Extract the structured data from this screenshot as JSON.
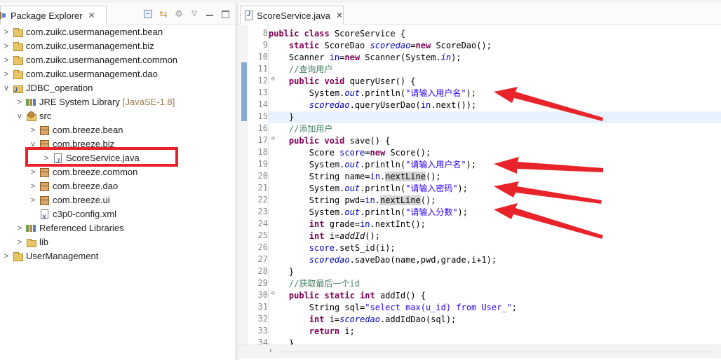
{
  "package_explorer": {
    "title": "Package Explorer",
    "close_glyph": "✕",
    "tools": [
      "collapse-all-icon",
      "link-with-editor-icon",
      "filters-icon",
      "view-menu-icon",
      "minimize-icon",
      "maximize-icon"
    ],
    "tree": [
      {
        "label": "com.zuikc.usermanagement.bean",
        "icon": "project-icon",
        "indent": 0,
        "toggle": ">"
      },
      {
        "label": "com.zuikc.usermanagement.biz",
        "icon": "project-icon",
        "indent": 0,
        "toggle": ">"
      },
      {
        "label": "com.zuikc.usermanagement.common",
        "icon": "project-icon",
        "indent": 0,
        "toggle": ">"
      },
      {
        "label": "com.zuikc.usermanagement.dao",
        "icon": "project-icon",
        "indent": 0,
        "toggle": ">"
      },
      {
        "label": "JDBC_operation",
        "icon": "java-project-icon",
        "indent": 0,
        "toggle": "v"
      },
      {
        "label": "JRE System Library",
        "decoration": "[JavaSE-1.8]",
        "icon": "library-icon",
        "indent": 1,
        "toggle": ">"
      },
      {
        "label": "src",
        "icon": "source-folder-icon",
        "indent": 1,
        "toggle": "v"
      },
      {
        "label": "com.breeze.bean",
        "icon": "package-icon",
        "indent": 2,
        "toggle": ">"
      },
      {
        "label": "com.breeze.biz",
        "icon": "package-icon",
        "indent": 2,
        "toggle": "v"
      },
      {
        "label": "ScoreService.java",
        "icon": "java-file-icon",
        "indent": 3,
        "toggle": ">"
      },
      {
        "label": "com.breeze.common",
        "icon": "package-icon",
        "indent": 2,
        "toggle": ">"
      },
      {
        "label": "com.breeze.dao",
        "icon": "package-icon",
        "indent": 2,
        "toggle": ">"
      },
      {
        "label": "com.breeze.ui",
        "icon": "package-icon",
        "indent": 2,
        "toggle": ">"
      },
      {
        "label": "c3p0-config.xml",
        "icon": "xml-file-icon",
        "indent": 2,
        "toggle": ""
      },
      {
        "label": "Referenced Libraries",
        "icon": "library-icon",
        "indent": 1,
        "toggle": ">"
      },
      {
        "label": "lib",
        "icon": "folder-icon",
        "indent": 1,
        "toggle": ">"
      },
      {
        "label": "UserManagement",
        "icon": "project-icon",
        "indent": 0,
        "toggle": ">"
      }
    ]
  },
  "editor": {
    "tab_title": "ScoreService.java",
    "close_glyph": "✕",
    "current_line": 15,
    "lines": [
      {
        "n": "8",
        "tokens": [
          [
            "kw",
            "public "
          ],
          [
            "kw",
            "class "
          ],
          [
            "",
            "ScoreService {"
          ]
        ]
      },
      {
        "n": "9",
        "tokens": [
          [
            "",
            "    "
          ],
          [
            "kw",
            "static "
          ],
          [
            "",
            "ScoreDao "
          ],
          [
            "sfld",
            "scoredao"
          ],
          [
            "",
            "="
          ],
          [
            "kw",
            "new "
          ],
          [
            "",
            "ScoreDao();"
          ]
        ]
      },
      {
        "n": "10",
        "tokens": [
          [
            "",
            "    Scanner "
          ],
          [
            "fld",
            "in"
          ],
          [
            "",
            "="
          ],
          [
            "kw",
            "new "
          ],
          [
            "",
            "Scanner(System."
          ],
          [
            "sfld",
            "in"
          ],
          [
            "",
            ");"
          ]
        ]
      },
      {
        "n": "11",
        "tokens": [
          [
            "",
            "    "
          ],
          [
            "com",
            "//查询用户"
          ]
        ]
      },
      {
        "n": "12",
        "fold": "⊖",
        "tokens": [
          [
            "",
            "    "
          ],
          [
            "kw",
            "public "
          ],
          [
            "kw",
            "void "
          ],
          [
            "",
            "queryUser() {"
          ]
        ]
      },
      {
        "n": "13",
        "tokens": [
          [
            "",
            "        System."
          ],
          [
            "sfld",
            "out"
          ],
          [
            "",
            ".println("
          ],
          [
            "str",
            "\"请输入用户名\""
          ],
          [
            "",
            ");"
          ]
        ]
      },
      {
        "n": "14",
        "tokens": [
          [
            "",
            "        "
          ],
          [
            "sfld",
            "scoredao"
          ],
          [
            "",
            ".queryUserDao("
          ],
          [
            "fld",
            "in"
          ],
          [
            "",
            ".next());"
          ]
        ]
      },
      {
        "n": "15",
        "tokens": [
          [
            "",
            "    }"
          ]
        ]
      },
      {
        "n": "16",
        "tokens": [
          [
            "",
            "    "
          ],
          [
            "com",
            "//添加用户"
          ]
        ]
      },
      {
        "n": "17",
        "fold": "⊖",
        "tokens": [
          [
            "",
            "    "
          ],
          [
            "kw",
            "public "
          ],
          [
            "kw",
            "void "
          ],
          [
            "",
            "save() {"
          ]
        ]
      },
      {
        "n": "18",
        "tokens": [
          [
            "",
            "        Score "
          ],
          [
            "fld",
            "score"
          ],
          [
            "",
            "="
          ],
          [
            "kw",
            "new "
          ],
          [
            "",
            "Score();"
          ]
        ]
      },
      {
        "n": "19",
        "tokens": [
          [
            "",
            "        System."
          ],
          [
            "sfld",
            "out"
          ],
          [
            "",
            ".println("
          ],
          [
            "str",
            "\"请输入用户名\""
          ],
          [
            "",
            ");"
          ]
        ]
      },
      {
        "n": "20",
        "tokens": [
          [
            "",
            "        String name="
          ],
          [
            "fld",
            "in"
          ],
          [
            "",
            "."
          ],
          [
            "occ",
            "nextLine"
          ],
          [
            "",
            "();"
          ]
        ]
      },
      {
        "n": "21",
        "tokens": [
          [
            "",
            "        System."
          ],
          [
            "sfld",
            "out"
          ],
          [
            "",
            ".println("
          ],
          [
            "str",
            "\"请输入密码\""
          ],
          [
            "",
            ");"
          ]
        ]
      },
      {
        "n": "22",
        "tokens": [
          [
            "",
            "        String pwd="
          ],
          [
            "fld",
            "in"
          ],
          [
            "",
            "."
          ],
          [
            "occ",
            "nextLine"
          ],
          [
            "",
            "();"
          ]
        ]
      },
      {
        "n": "23",
        "tokens": [
          [
            "",
            "        System."
          ],
          [
            "sfld",
            "out"
          ],
          [
            "",
            ".println("
          ],
          [
            "str",
            "\"请输入分数\""
          ],
          [
            "",
            ");"
          ]
        ]
      },
      {
        "n": "24",
        "tokens": [
          [
            "",
            "        "
          ],
          [
            "kw",
            "int "
          ],
          [
            "",
            "grade="
          ],
          [
            "fld",
            "in"
          ],
          [
            "",
            ".nextInt();"
          ]
        ]
      },
      {
        "n": "25",
        "tokens": [
          [
            "",
            "        "
          ],
          [
            "kw",
            "int "
          ],
          [
            "",
            "i="
          ],
          [
            "mth",
            "addId"
          ],
          [
            "",
            "();"
          ]
        ]
      },
      {
        "n": "26",
        "tokens": [
          [
            "",
            "        "
          ],
          [
            "fld",
            "score"
          ],
          [
            "",
            ".setS_id(i);"
          ]
        ]
      },
      {
        "n": "27",
        "tokens": [
          [
            "",
            "        "
          ],
          [
            "sfld",
            "scoredao"
          ],
          [
            "",
            ".saveDao(name,pwd,grade,i+1);"
          ]
        ]
      },
      {
        "n": "28",
        "tokens": [
          [
            "",
            "    }"
          ]
        ]
      },
      {
        "n": "29",
        "tokens": [
          [
            "",
            "    "
          ],
          [
            "com",
            "//获取最后一个id"
          ]
        ]
      },
      {
        "n": "30",
        "fold": "⊖",
        "tokens": [
          [
            "",
            "    "
          ],
          [
            "kw",
            "public "
          ],
          [
            "kw",
            "static "
          ],
          [
            "kw",
            "int "
          ],
          [
            "",
            "addId() {"
          ]
        ]
      },
      {
        "n": "31",
        "tokens": [
          [
            "",
            "        String sql="
          ],
          [
            "str",
            "\"select max(u_id) from User_\""
          ],
          [
            "",
            ";"
          ]
        ]
      },
      {
        "n": "32",
        "tokens": [
          [
            "",
            "        "
          ],
          [
            "kw",
            "int "
          ],
          [
            "",
            "i="
          ],
          [
            "sfld",
            "scoredao"
          ],
          [
            "",
            ".addIdDao(sql);"
          ]
        ]
      },
      {
        "n": "33",
        "tokens": [
          [
            "",
            "        "
          ],
          [
            "kw",
            "return "
          ],
          [
            "",
            "i;"
          ]
        ]
      },
      {
        "n": "34",
        "tokens": [
          [
            "",
            "    }"
          ]
        ]
      }
    ]
  },
  "colors": {
    "annotation_red": "#e8242a",
    "keyword": "#7f0055",
    "string": "#2a00ff",
    "comment": "#3f7f5f",
    "field": "#0000c0"
  }
}
